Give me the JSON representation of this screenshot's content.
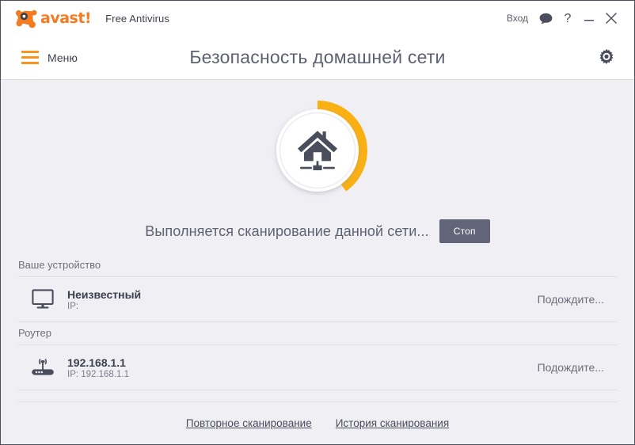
{
  "window": {
    "brand_word": "avast!",
    "product_name": "Free Antivirus",
    "login_label": "Вход",
    "icons": {
      "chat": "chat-bubble-icon",
      "help": "help-question-icon",
      "minimize": "minimize-icon",
      "close": "close-icon"
    }
  },
  "header": {
    "menu_label": "Меню",
    "title": "Безопасность домашней сети",
    "settings_icon": "gear-icon"
  },
  "scan": {
    "icon": "home-network-icon",
    "progress_percent": 40,
    "arc_color": "#fbb012",
    "track_color": "#f0eff4",
    "status_text": "Выполняется сканирование данной сети...",
    "stop_label": "Стоп"
  },
  "sections": [
    {
      "label": "Ваше устройство",
      "rows": [
        {
          "icon": "monitor-icon",
          "name": "Неизвестный",
          "ip": "IP:",
          "status": "Подождите..."
        }
      ]
    },
    {
      "label": "Роутер",
      "rows": [
        {
          "icon": "router-icon",
          "name": "192.168.1.1",
          "ip": "IP: 192.168.1.1",
          "status": "Подождите..."
        }
      ]
    }
  ],
  "footer": {
    "rescan_label": "Повторное сканирование",
    "history_label": "История сканирования"
  },
  "colors": {
    "accent_orange": "#f7941e",
    "progress_amber": "#fbb012",
    "body_bg": "#f0eff4",
    "text_dark": "#3c3f4c",
    "stop_bg": "#62657a"
  }
}
